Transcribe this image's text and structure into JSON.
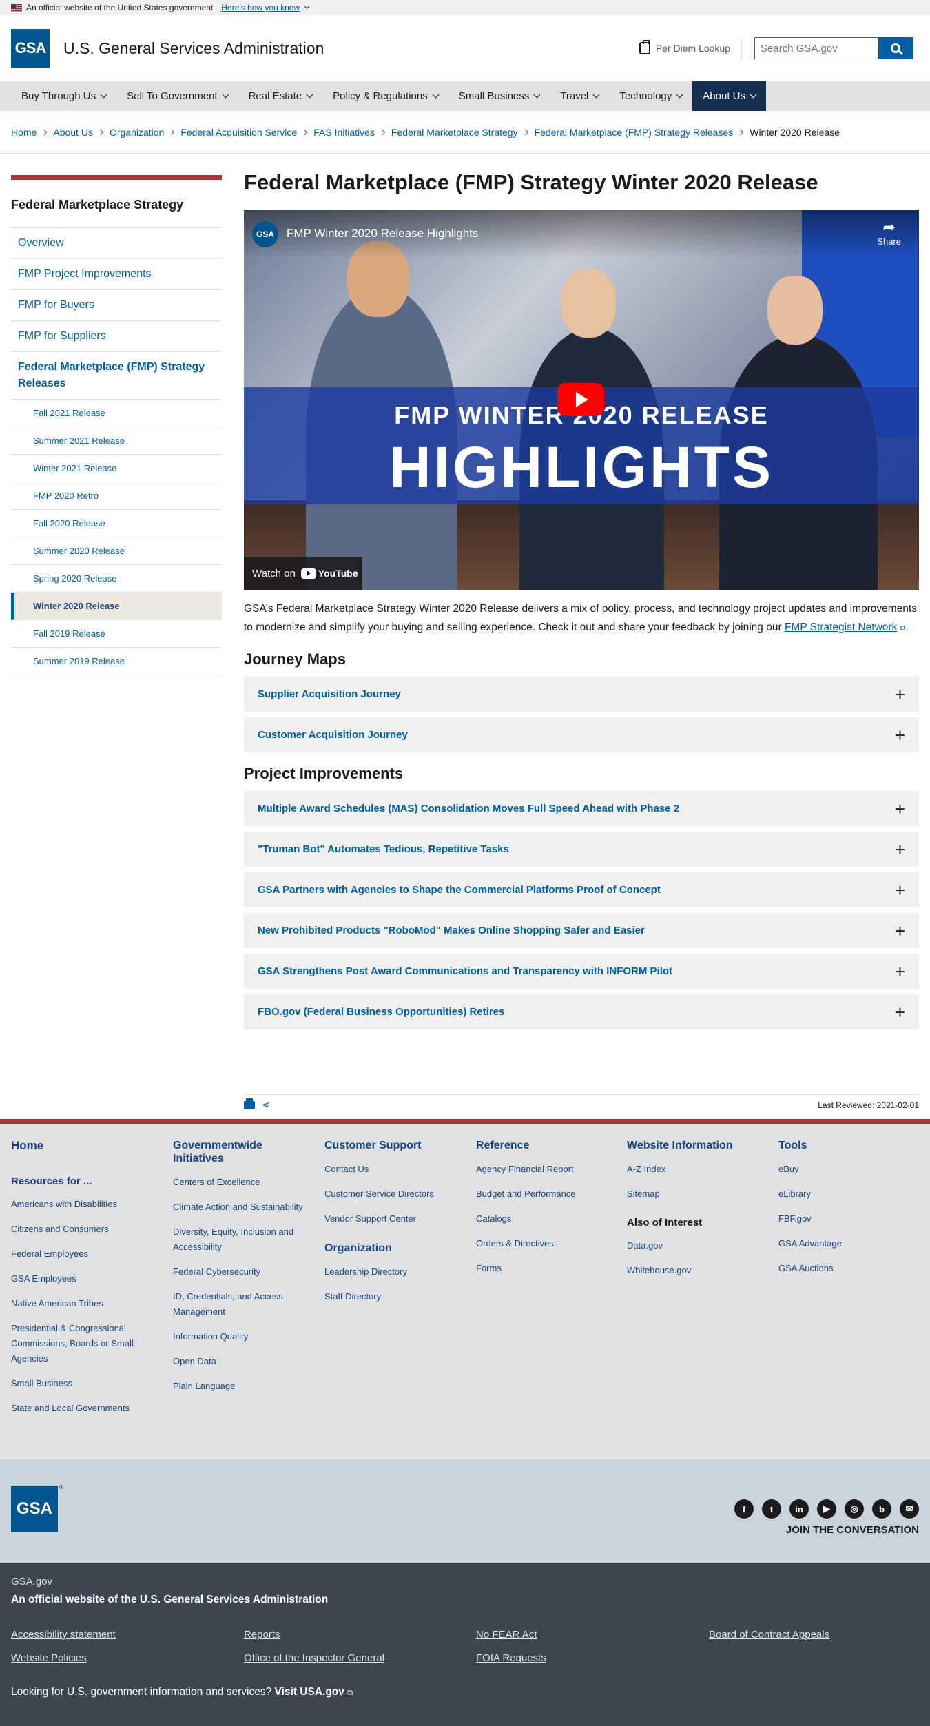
{
  "gov_banner": {
    "text": "An official website of the United States government",
    "link": "Here’s how you know"
  },
  "header": {
    "logo_text": "GSA",
    "agency_name": "U.S. General Services Administration",
    "per_diem": "Per Diem Lookup",
    "search_placeholder": "Search GSA.gov"
  },
  "nav": [
    {
      "label": "Buy Through Us"
    },
    {
      "label": "Sell To Government"
    },
    {
      "label": "Real Estate"
    },
    {
      "label": "Policy & Regulations"
    },
    {
      "label": "Small Business"
    },
    {
      "label": "Travel"
    },
    {
      "label": "Technology"
    },
    {
      "label": "About Us"
    }
  ],
  "breadcrumb": {
    "items": [
      "Home",
      "About Us",
      "Organization",
      "Federal Acquisition Service",
      "FAS Initiatives",
      "Federal Marketplace Strategy",
      "Federal Marketplace (FMP) Strategy Releases"
    ],
    "current": "Winter 2020 Release"
  },
  "sidenav": {
    "title": "Federal Marketplace Strategy",
    "items": [
      "Overview",
      "FMP Project Improvements",
      "FMP for Buyers",
      "FMP for Suppliers"
    ],
    "section": "Federal Marketplace (FMP) Strategy Releases",
    "subitems": [
      "Fall 2021 Release",
      "Summer 2021 Release",
      "Winter 2021 Release",
      "FMP 2020 Retro",
      "Fall 2020 Release",
      "Summer 2020 Release",
      "Spring 2020 Release",
      "Winter 2020 Release",
      "Fall 2019 Release",
      "Summer 2019 Release"
    ]
  },
  "content": {
    "title": "Federal Marketplace (FMP) Strategy Winter 2020 Release",
    "video": {
      "channel_logo": "GSA",
      "title": "FMP Winter 2020 Release Highlights",
      "share": "Share",
      "overlay_line1": "FMP WINTER 2020 RELEASE",
      "overlay_line2": "HIGHLIGHTS",
      "watch_on": "Watch on",
      "youtube": "YouTube"
    },
    "intro_text": "GSA’s Federal Marketplace Strategy Winter 2020 Release delivers a mix of policy, process, and technology project updates and improvements to modernize and simplify your buying and selling experience. Check it out and share your feedback by joining our ",
    "intro_link": "FMP Strategist Network",
    "journey_heading": "Journey Maps",
    "journey_items": [
      "Supplier Acquisition Journey",
      "Customer Acquisition Journey"
    ],
    "projects_heading": "Project Improvements",
    "project_items": [
      "Multiple Award Schedules (MAS) Consolidation Moves Full Speed Ahead with Phase 2",
      "\"Truman Bot\" Automates Tedious, Repetitive Tasks",
      "GSA Partners with Agencies to Shape the Commercial Platforms Proof of Concept",
      "New Prohibited Products \"RoboMod\" Makes Online Shopping Safer and Easier",
      "GSA Strengthens Post Award Communications and Transparency with INFORM Pilot",
      "FBO.gov (Federal Business Opportunities) Retires"
    ],
    "last_reviewed": "Last Reviewed: 2021-02-01"
  },
  "footer": {
    "home": "Home",
    "resources_heading": "Resources for ...",
    "resources": [
      "Americans with Disabilities",
      "Citizens and Consumers",
      "Federal Employees",
      "GSA Employees",
      "Native American Tribes",
      "Presidential & Congressional Commissions, Boards or Small Agencies",
      "Small Business",
      "State and Local Governments"
    ],
    "governmentwide_heading": "Governmentwide Initiatives",
    "governmentwide": [
      "Centers of Excellence",
      "Climate Action and Sustainability",
      "Diversity, Equity, Inclusion and Accessibility",
      "Federal Cybersecurity",
      "ID, Credentials, and Access Management",
      "Information Quality",
      "Open Data",
      "Plain Language"
    ],
    "support_heading": "Customer Support",
    "support": [
      "Contact Us",
      "Customer Service Directors",
      "Vendor Support Center"
    ],
    "organization_heading": "Organization",
    "organization": [
      "Leadership Directory",
      "Staff Directory"
    ],
    "reference_heading": "Reference",
    "reference": [
      "Agency Financial Report",
      "Budget and Performance",
      "Catalogs",
      "Orders & Directives",
      "Forms"
    ],
    "website_heading": "Website Information",
    "website": [
      "A-Z Index",
      "Sitemap"
    ],
    "interest_heading": "Also of Interest",
    "interest": [
      "Data.gov",
      "Whitehouse.gov"
    ],
    "tools_heading": "Tools",
    "tools": [
      "eBuy",
      "eLibrary",
      "FBF.gov",
      "GSA Advantage",
      "GSA Auctions"
    ],
    "logo_text": "GSA",
    "registered": "®",
    "social_icons": [
      "facebook-icon",
      "twitter-icon",
      "linkedin-icon",
      "youtube-icon",
      "instagram-icon",
      "blog-icon",
      "email-icon"
    ],
    "join": "JOIN THE CONVERSATION",
    "domain": "GSA.gov",
    "official": "An official website of the U.S. General Services Administration",
    "bottom_links": [
      "Accessibility statement",
      "Reports",
      "No FEAR Act",
      "Board of Contract Appeals",
      "Website Policies",
      "Office of the Inspector General",
      "FOIA Requests"
    ],
    "usa_text": "Looking for U.S. government information and services? ",
    "usa_link": "Visit USA.gov"
  }
}
